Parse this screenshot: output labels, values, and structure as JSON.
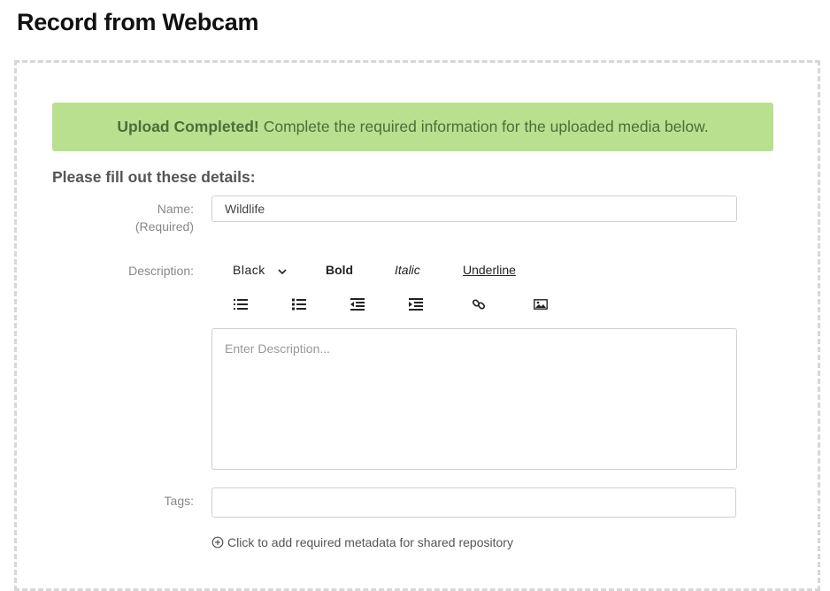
{
  "page": {
    "title": "Record from Webcam"
  },
  "alert": {
    "strong": "Upload Completed!",
    "message": "Complete the required information for the uploaded media below."
  },
  "form": {
    "heading": "Please fill out these details:",
    "name": {
      "label": "Name:",
      "required": "(Required)",
      "value": "Wildlife"
    },
    "description": {
      "label": "Description:",
      "placeholder": "Enter Description...",
      "toolbar": {
        "color": "Black",
        "bold": "Bold",
        "italic": "Italic",
        "underline": "Underline",
        "icons": [
          "ordered-list-icon",
          "unordered-list-icon",
          "outdent-icon",
          "indent-icon",
          "link-icon",
          "image-icon"
        ]
      }
    },
    "tags": {
      "label": "Tags:",
      "value": ""
    },
    "metadata_link": "Click to add required metadata for shared repository"
  }
}
